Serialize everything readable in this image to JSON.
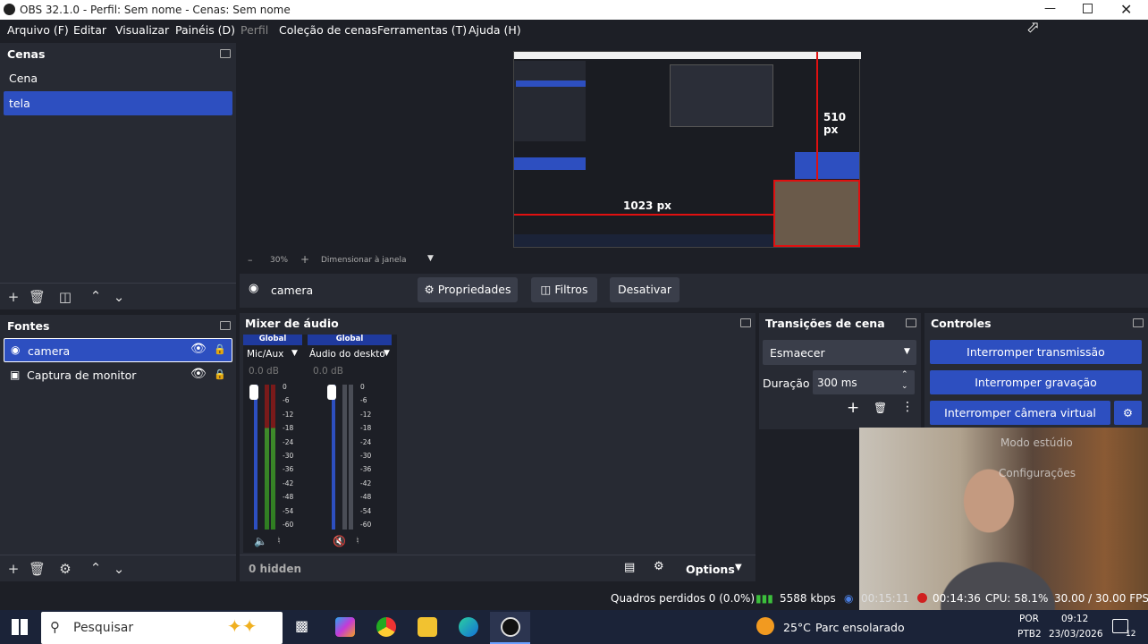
{
  "window": {
    "title": "OBS 32.1.0 - Perfil: Sem nome - Cenas: Sem nome"
  },
  "menu": [
    "Arquivo (F)",
    "Editar",
    "Visualizar",
    "Painéis (D)",
    "Perfil",
    "Coleção de cenas",
    "Ferramentas (T)",
    "Ajuda (H)"
  ],
  "scenes": {
    "title": "Cenas",
    "items": [
      "Cena",
      "tela"
    ],
    "selected": "tela"
  },
  "sources": {
    "title": "Fontes",
    "items": [
      "camera",
      "Captura de monitor"
    ],
    "selected": "camera"
  },
  "preview": {
    "zoom": "30%",
    "zoom_mode": "Dimensionar à janela",
    "measure_h": "510 px",
    "measure_w": "1023 px"
  },
  "source_bar": {
    "name": "camera",
    "properties": "Propriedades",
    "filters": "Filtros",
    "deactivate": "Desativar"
  },
  "mixer": {
    "title": "Mixer de áudio",
    "channels": [
      {
        "badge": "Global",
        "name": "Mic/Aux",
        "db": "0.0 dB"
      },
      {
        "badge": "Global",
        "name": "Áudio do deskto",
        "db": "0.0 dB"
      }
    ],
    "ticks": [
      "0",
      "-6",
      "-12",
      "-18",
      "-24",
      "-30",
      "-36",
      "-42",
      "-48",
      "-54",
      "-60"
    ],
    "hidden": "0 hidden",
    "options": "Options"
  },
  "transitions": {
    "title": "Transições de cena",
    "selected": "Esmaecer",
    "duration_label": "Duração",
    "duration": "300 ms"
  },
  "controls": {
    "title": "Controles",
    "stop_stream": "Interromper transmissão",
    "stop_record": "Interromper gravação",
    "stop_vcam": "Interromper câmera virtual",
    "studio_mode": "Modo estúdio",
    "settings": "Configurações"
  },
  "status": {
    "dropped": "Quadros perdidos 0 (0.0%)",
    "bitrate": "5588 kbps",
    "stream_time": "00:15:11",
    "record_time": "00:14:36",
    "cpu": "CPU: 58.1%",
    "fps": "30.00 / 30.00 FPS"
  },
  "taskbar": {
    "search": "Pesquisar",
    "weather": "25°C",
    "weather_desc": "Parc ensolarado",
    "lang1": "POR",
    "lang2": "PTB2",
    "time": "09:12",
    "date": "23/03/2026",
    "notif": "12"
  },
  "colors": {
    "accent": "#2d4fc0",
    "bg": "#1d1f26",
    "dock": "#272a33"
  }
}
